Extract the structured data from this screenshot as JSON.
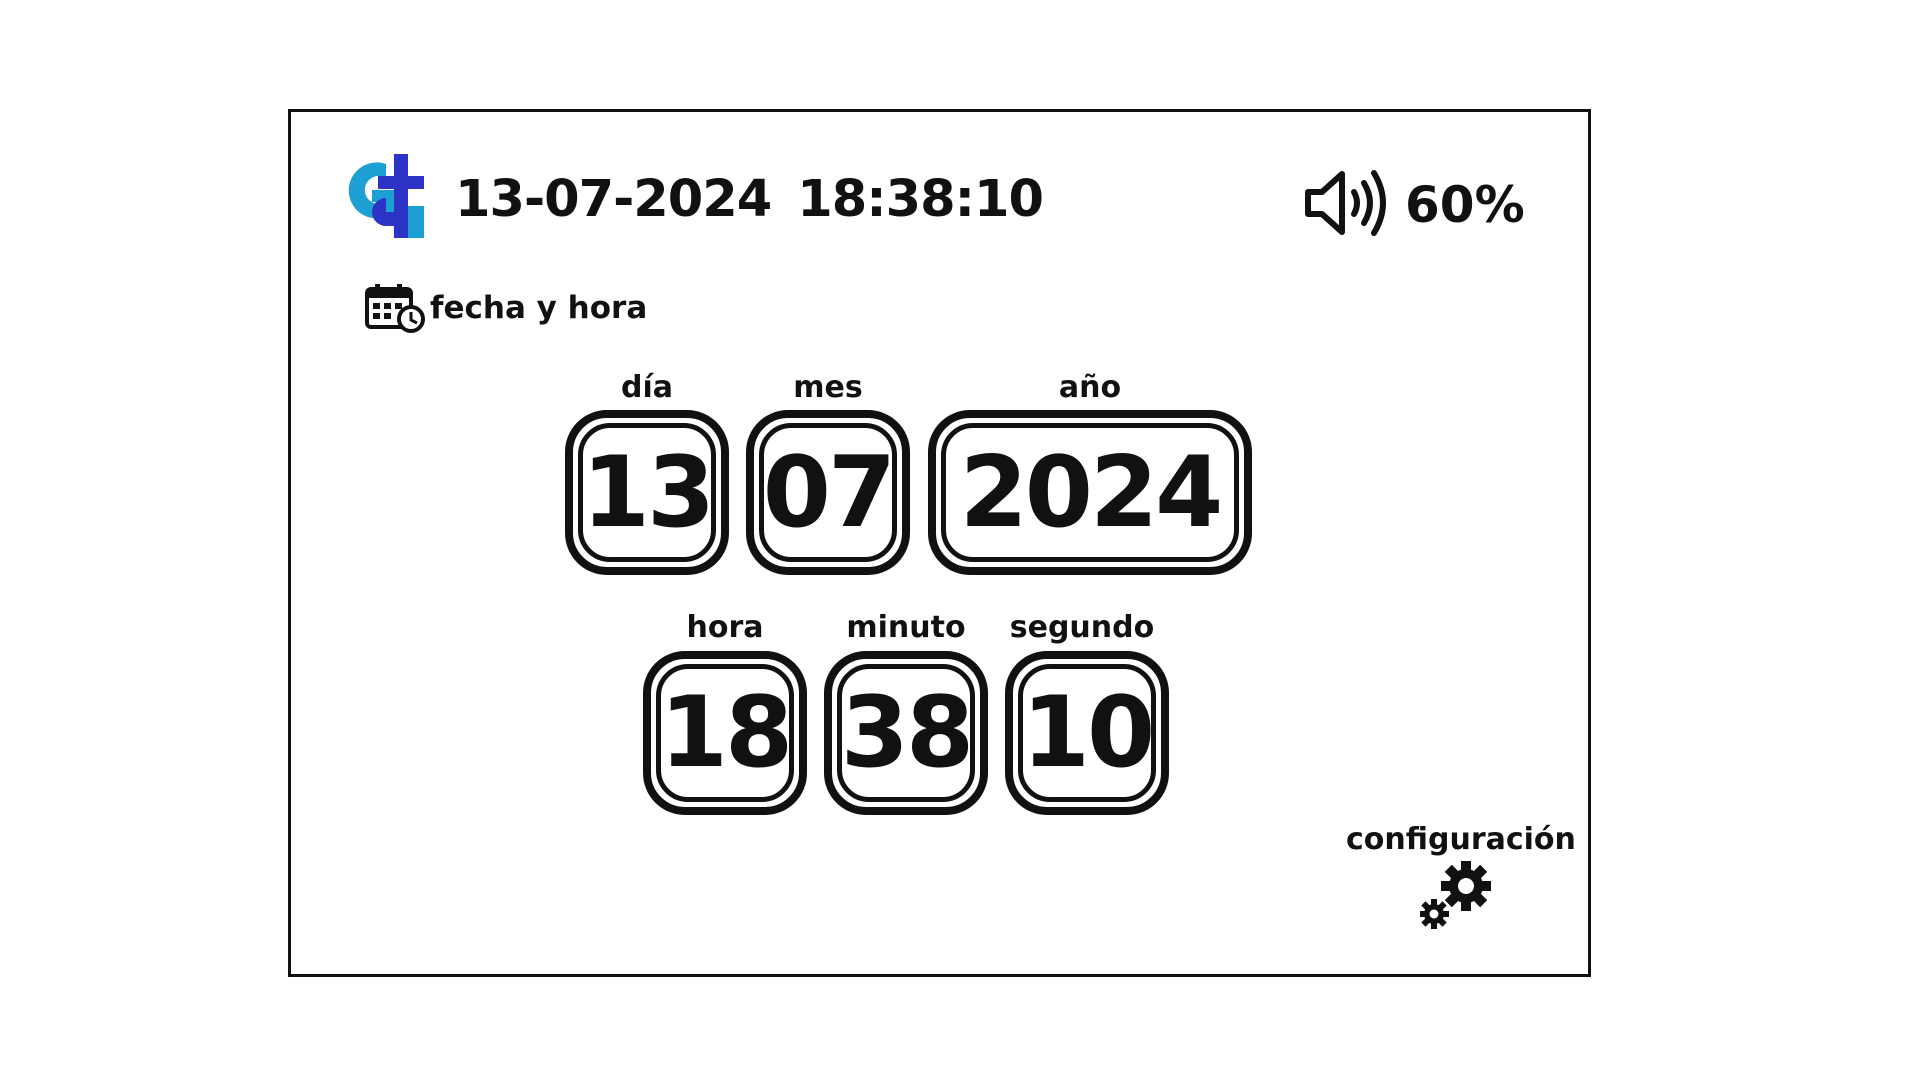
{
  "header": {
    "date": "13-07-2024",
    "time": "18:38:10",
    "volume": "60%",
    "logo_colors": {
      "blue": "#2E33C8",
      "teal": "#1E9FD4"
    }
  },
  "section": {
    "title": "fecha y hora",
    "icon": "calendar-clock-icon"
  },
  "date_fields": {
    "day": {
      "label": "día",
      "value": "13"
    },
    "month": {
      "label": "mes",
      "value": "07"
    },
    "year": {
      "label": "año",
      "value": "2024"
    }
  },
  "time_fields": {
    "hour": {
      "label": "hora",
      "value": "18"
    },
    "minute": {
      "label": "minuto",
      "value": "38"
    },
    "second": {
      "label": "segundo",
      "value": "10"
    }
  },
  "config": {
    "label": "configuración",
    "icon": "gears-icon"
  }
}
